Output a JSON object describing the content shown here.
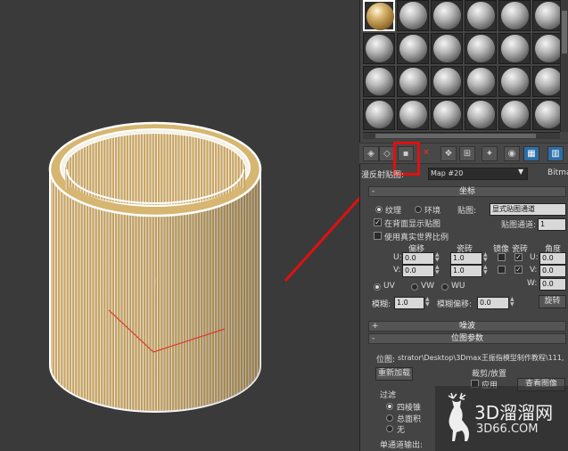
{
  "viewport": {
    "arrow_color": "#e01010"
  },
  "material_editor": {
    "slot_rows": 4,
    "slot_cols": 6,
    "selected_slot": 0,
    "toolbar": {
      "bitmap_label": "Bitmap",
      "map_label": "漫反射贴图:",
      "map_name": "Map #20"
    }
  },
  "coordinates": {
    "title": "坐标",
    "texture": "纹理",
    "environ": "环境",
    "mapping_label": "贴图:",
    "mapping_value": "显式贴图通道",
    "show_map_on_back": "在背面显示贴图",
    "map_channel_label": "贴图通道:",
    "map_channel_value": "1",
    "real_world": "使用真实世界比例",
    "offset_label": "偏移",
    "tiling_label": "瓷砖",
    "mirror_label": "镜像",
    "tile_label": "瓷砖",
    "angle_label": "角度",
    "u_label": "U:",
    "v_label": "V:",
    "w_label": "W:",
    "u_offset": "0.0",
    "v_offset": "0.0",
    "u_tiling": "1.0",
    "v_tiling": "1.0",
    "u_angle": "0.0",
    "v_angle": "0.0",
    "w_angle": "0.0",
    "uv": "UV",
    "vw": "VW",
    "wu": "WU",
    "blur_label": "模糊:",
    "blur_value": "1.0",
    "blur_offset_label": "模糊偏移:",
    "blur_offset_value": "0.0",
    "rotate_button": "旋转"
  },
  "noise": {
    "title": "噪波"
  },
  "bitmap_params": {
    "title": "位图参数",
    "bitmap_label": "位图:",
    "bitmap_path": "strator\\Desktop\\3Dmax王振指模型制作教程\\111,",
    "reload_button": "重新加载",
    "crop_label": "裁剪/放置",
    "apply_label": "应用",
    "view_image": "查看图像",
    "filter_label": "过滤",
    "pyramidal": "四棱锥",
    "summed_area": "总面积",
    "none": "无",
    "mono_output": "单通道输出:"
  },
  "watermark": {
    "line1": "3D溜溜网",
    "line2": "3D66.COM"
  }
}
